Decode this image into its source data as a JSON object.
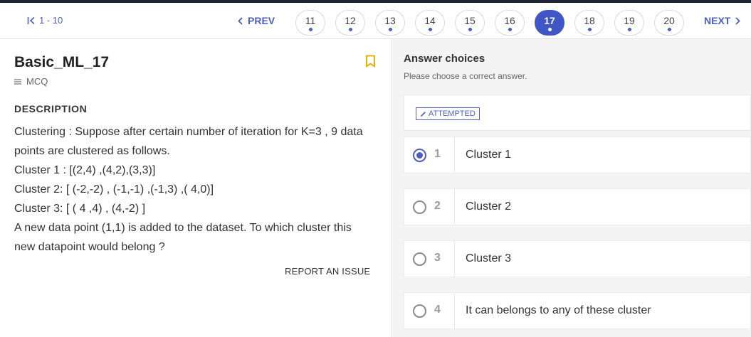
{
  "pager": {
    "first_label": "1 - 10",
    "prev_label": "PREV",
    "next_label": "NEXT",
    "current": "17",
    "pages": [
      "11",
      "12",
      "13",
      "14",
      "15",
      "16",
      "17",
      "18",
      "19",
      "20"
    ],
    "accent": "#4056c7"
  },
  "question": {
    "title": "Basic_ML_17",
    "type": "MCQ",
    "description_heading": "DESCRIPTION",
    "description_lines": [
      "Clustering : Suppose after certain number of iteration for K=3 , 9 data",
      "points are clustered as follows.",
      "Cluster 1 : [(2,4) ,(4,2),(3,3)]",
      "Cluster 2: [ (-2,-2) , (-1,-1) ,(-1,3) ,( 4,0)]",
      "Cluster 3: [ ( 4 ,4) , (4,-2) ]",
      "A new data point (1,1) is added to the dataset. To which cluster this",
      "new datapoint would belong ?"
    ],
    "report_label": "REPORT AN ISSUE",
    "bookmark_icon": "bookmark-icon"
  },
  "answers": {
    "heading": "Answer choices",
    "subheading": "Please choose a correct answer.",
    "status": "ATTEMPTED",
    "selected": "1",
    "choices": [
      {
        "num": "1",
        "text": "Cluster 1"
      },
      {
        "num": "2",
        "text": "Cluster 2"
      },
      {
        "num": "3",
        "text": "Cluster 3"
      },
      {
        "num": "4",
        "text": "It can belongs to any of these cluster"
      }
    ]
  }
}
